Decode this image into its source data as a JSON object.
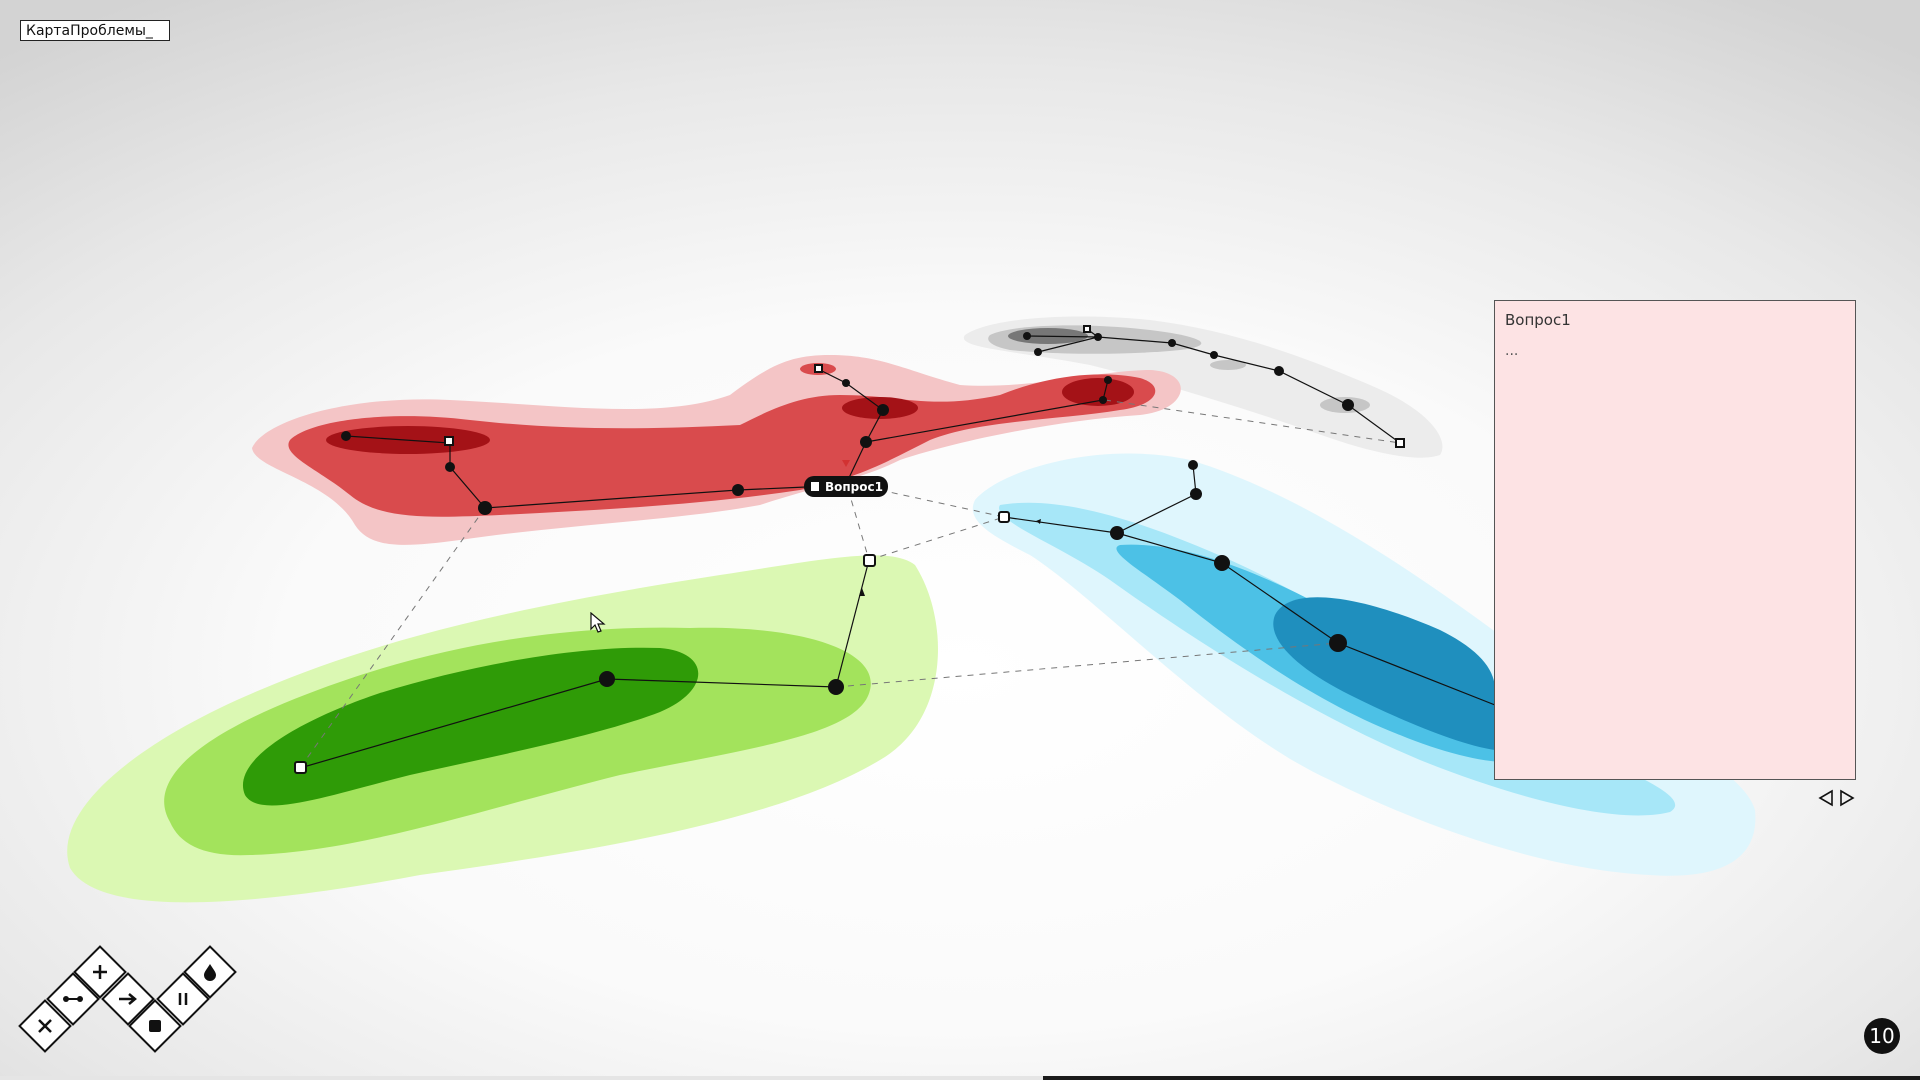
{
  "title_field": {
    "value": "КартаПроблемы_"
  },
  "map": {
    "node_tag": {
      "label": "Вопрос1"
    },
    "colors": {
      "red": [
        "#f4c5c6",
        "#d94b4d",
        "#a41217"
      ],
      "green": [
        "#dbf8b3",
        "#a3e35c",
        "#2f9b07"
      ],
      "blue": [
        "#dff6fd",
        "#a7e7f8",
        "#4cc1e6",
        "#1f8fbe"
      ],
      "gray": [
        "#ececec",
        "#c6c6c6",
        "#777777"
      ]
    }
  },
  "panel": {
    "title": "Вопрос1",
    "body": "..."
  },
  "pager": {
    "prev_icon": "triangle-left-icon",
    "next_icon": "triangle-right-icon"
  },
  "toolbar": {
    "tools": [
      "delete-icon",
      "connect-icon",
      "add-icon",
      "arrow-right-icon",
      "square-icon",
      "parallel-icon",
      "drop-icon"
    ]
  },
  "counter": {
    "value": "10"
  },
  "progress": {
    "start": 0.543,
    "end": 1.0
  }
}
